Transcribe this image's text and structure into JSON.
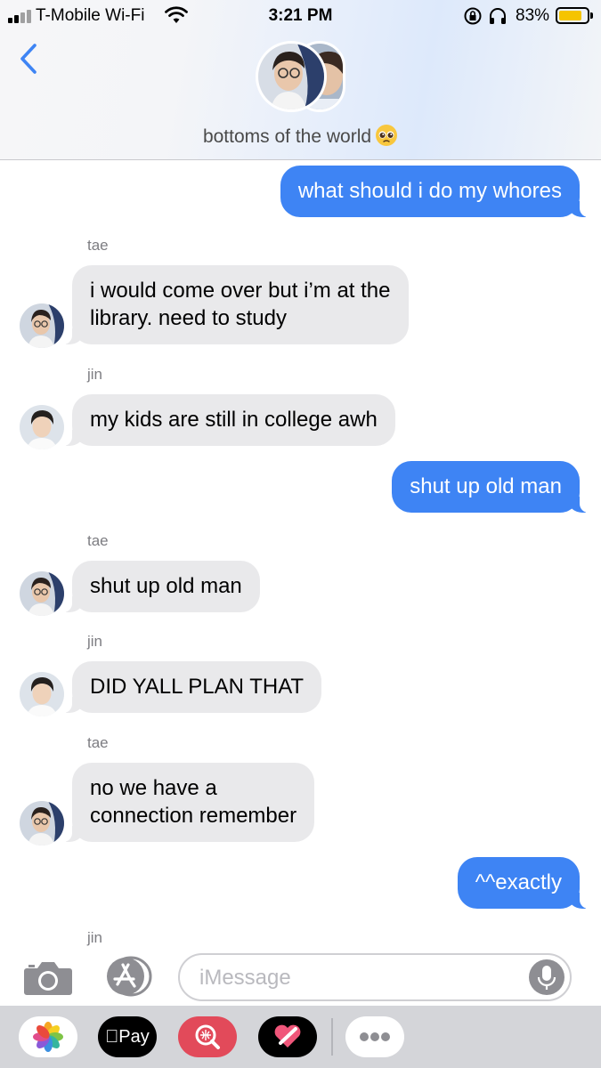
{
  "status_bar": {
    "carrier": "T-Mobile Wi-Fi",
    "time": "3:21 PM",
    "battery_percent": "83%",
    "battery_level": 0.83,
    "icons": [
      "signal-bars-icon",
      "wifi-icon",
      "orientation-lock-icon",
      "headphones-icon",
      "battery-icon"
    ]
  },
  "header": {
    "back_icon": "chevron-left-icon",
    "group_name": "bottoms of the world",
    "group_emoji": "pleading-face-emoji"
  },
  "messages": [
    {
      "direction": "out",
      "text_lines": [
        "what should i do my whores"
      ]
    },
    {
      "direction": "in",
      "sender": "tae",
      "text_lines": [
        "i would come over but i’m at the",
        "library. need to study"
      ]
    },
    {
      "direction": "in",
      "sender": "jin",
      "text_lines": [
        "my kids are still in college awh"
      ]
    },
    {
      "direction": "out",
      "text_lines": [
        "shut up old man"
      ]
    },
    {
      "direction": "in",
      "sender": "tae",
      "text_lines": [
        "shut up old man"
      ]
    },
    {
      "direction": "in",
      "sender": "jin",
      "text_lines": [
        "DID YALL PLAN THAT"
      ]
    },
    {
      "direction": "in",
      "sender": "tae",
      "text_lines": [
        "no we have a",
        "connection remember"
      ]
    },
    {
      "direction": "out",
      "text_lines": [
        "^^exactly"
      ]
    }
  ],
  "trailing_sender": "jin",
  "composer": {
    "placeholder": "iMessage",
    "icons": [
      "camera-icon",
      "app-store-icon",
      "microphone-icon"
    ]
  },
  "app_drawer": {
    "apple_pay_label": "Pay",
    "icons": [
      "photos-icon",
      "apple-pay-icon",
      "image-search-icon",
      "digital-touch-icon",
      "more-apps-icon"
    ]
  },
  "colors": {
    "outgoing_bubble": "#3e84f4",
    "incoming_bubble": "#e9e9eb",
    "battery_fill": "#f5c400"
  }
}
